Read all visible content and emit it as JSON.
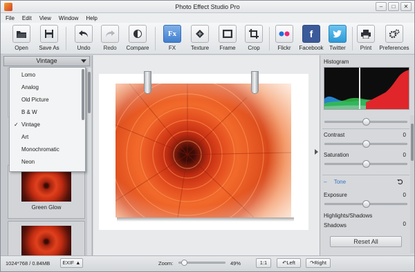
{
  "window": {
    "title": "Photo Effect Studio Pro"
  },
  "menu": [
    "File",
    "Edit",
    "View",
    "Window",
    "Help"
  ],
  "toolbar": {
    "open": "Open",
    "save_as": "Save As",
    "undo": "Undo",
    "redo": "Redo",
    "compare": "Compare",
    "fx": "FX",
    "fx_icon_text": "Fx",
    "texture": "Texture",
    "frame": "Frame",
    "crop": "Crop",
    "flickr": "Flickr",
    "facebook": "Facebook",
    "twitter": "Twitter",
    "print": "Print",
    "preferences": "Preferences"
  },
  "effects_panel": {
    "category": "Vintage",
    "categories": [
      "Lomo",
      "Analog",
      "Old Picture",
      "B & W",
      "Vintage",
      "Art",
      "Monochromatic",
      "Neon"
    ],
    "checked_index": 4,
    "check_mark": "✓",
    "presets": [
      {
        "name": "Green Glow"
      }
    ]
  },
  "adjust_panel": {
    "histogram_label": "Histogram",
    "contrast_label": "Contrast",
    "contrast_value": "0",
    "saturation_label": "Saturation",
    "saturation_value": "0",
    "tone_label": "Tone",
    "tone_collapse": "–",
    "exposure_label": "Exposure",
    "exposure_value": "0",
    "highlights_shadows_label": "Highlights/Shadows",
    "shadows_label": "Shadows",
    "shadows_value": "0",
    "reset_label": "Reset All",
    "slider_levels": {
      "top": 0.5,
      "contrast": 0.5,
      "saturation": 0.5,
      "exposure": 0.5
    }
  },
  "status_bar": {
    "image_info": "1024*768 / 0.84MB",
    "exif": "EXIF ▲",
    "zoom_label": "Zoom:",
    "zoom_value": "49%",
    "zoom_level": 0.05,
    "actual_size": "1:1",
    "rotate_left": "Left",
    "rotate_right": "Right"
  },
  "colors": {
    "accent": "#3f7fcf",
    "tone_link": "#3a73c4",
    "histogram_red": "#e0262a",
    "histogram_green": "#34c04a",
    "histogram_blue": "#2a8fe0"
  }
}
